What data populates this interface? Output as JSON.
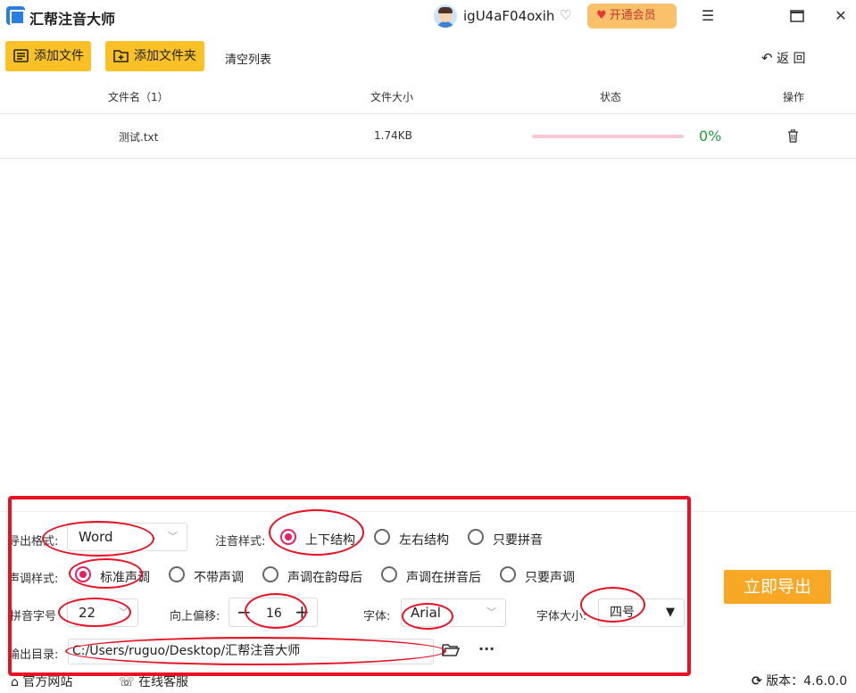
{
  "app": {
    "title": "汇帮注音大师",
    "username": "igU4aF04oxih",
    "vip_label": "开通会员"
  },
  "toolbar": {
    "add_file": "添加文件",
    "add_folder": "添加文件夹",
    "clear_list": "清空列表",
    "back": "返 回"
  },
  "table": {
    "headers": [
      "文件名（1）",
      "文件大小",
      "状态",
      "操作"
    ],
    "rows": [
      {
        "name": "测试.txt",
        "size": "1.74KB",
        "progress": 0,
        "progress_label": "0%"
      }
    ]
  },
  "settings": {
    "format_label": "导出格式:",
    "format_value": "Word",
    "style_label": "注音样式:",
    "style_options": [
      "上下结构",
      "左右结构",
      "只要拼音"
    ],
    "style_selected": 0,
    "tone_label": "声调样式:",
    "tone_options": [
      "标准声调",
      "不带声调",
      "声调在韵母后",
      "声调在拼音后",
      "只要声调"
    ],
    "tone_selected": 0,
    "pinyin_size_label": "拼音字号",
    "pinyin_size_value": "22",
    "offset_label": "向上偏移:",
    "offset_value": "16",
    "font_label": "字体:",
    "font_value": "Arial",
    "font_size_label": "字体大小:",
    "font_size_value": "四号",
    "output_label": "输出目录:",
    "output_path": "C:/Users/ruguo/Desktop/汇帮注音大师",
    "more": "···"
  },
  "export_button": "立即导出",
  "footer": {
    "website": "官方网站",
    "support": "在线客服",
    "version": "版本：4.6.0.0"
  },
  "colors": {
    "accent": "#f9c125",
    "radio": "#e91e63",
    "progress_ok": "#1e9e3a",
    "annotation": "#e81123"
  }
}
